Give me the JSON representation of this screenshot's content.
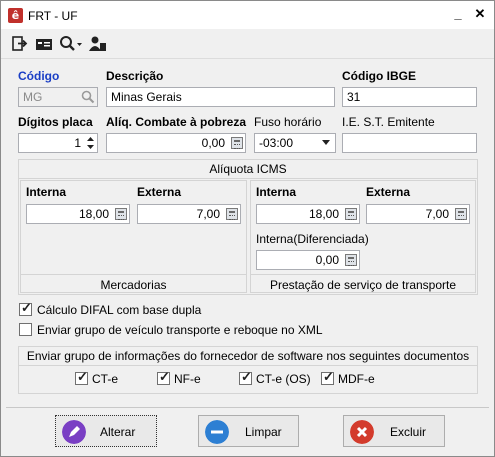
{
  "window": {
    "title": "FRT - UF",
    "app_icon_letter": "ê"
  },
  "toolbar": {
    "icons": [
      "exit-icon",
      "id-card-icon",
      "search-icon",
      "user-icon"
    ]
  },
  "form": {
    "codigo": {
      "label": "Código",
      "value": "MG"
    },
    "descricao": {
      "label": "Descrição",
      "value": "Minas Gerais"
    },
    "codigo_ibge": {
      "label": "Código IBGE",
      "value": "31"
    },
    "digitos_placa": {
      "label": "Dígitos placa",
      "value": "1"
    },
    "aliq_combate_pobreza": {
      "label": "Alíq. Combate à pobreza",
      "value": "0,00"
    },
    "fuso_horario": {
      "label": "Fuso horário",
      "value": "-03:00"
    },
    "ie_st_emitente": {
      "label": "I.E. S.T.  Emitente",
      "value": ""
    }
  },
  "aliquota_icms": {
    "title": "Alíquota ICMS",
    "mercadorias": {
      "caption": "Mercadorias",
      "interna_label": "Interna",
      "interna_value": "18,00",
      "externa_label": "Externa",
      "externa_value": "7,00"
    },
    "transporte": {
      "caption": "Prestação de serviço de transporte",
      "interna_label": "Interna",
      "interna_value": "18,00",
      "externa_label": "Externa",
      "externa_value": "7,00",
      "diferenciada_label": "Interna(Diferenciada)",
      "diferenciada_value": "0,00"
    }
  },
  "options": {
    "difal": {
      "label": "Cálculo DIFAL com base dupla",
      "checked": true
    },
    "veiculo": {
      "label": "Enviar grupo de veículo transporte e reboque no XML",
      "checked": false
    }
  },
  "software_group": {
    "title": "Enviar grupo de informações do fornecedor de software nos seguintes documentos",
    "items": [
      {
        "label": "CT-e",
        "checked": true
      },
      {
        "label": "NF-e",
        "checked": true
      },
      {
        "label": "CT-e (OS)",
        "checked": true
      },
      {
        "label": "MDF-e",
        "checked": true
      }
    ]
  },
  "buttons": {
    "alterar": "Alterar",
    "limpar": "Limpar",
    "excluir": "Excluir"
  },
  "colors": {
    "label_blue": "#1a3ec5",
    "alterar_icon": "#7a3fc4",
    "limpar_icon": "#2d7fd3",
    "excluir_icon": "#d33b2c"
  }
}
